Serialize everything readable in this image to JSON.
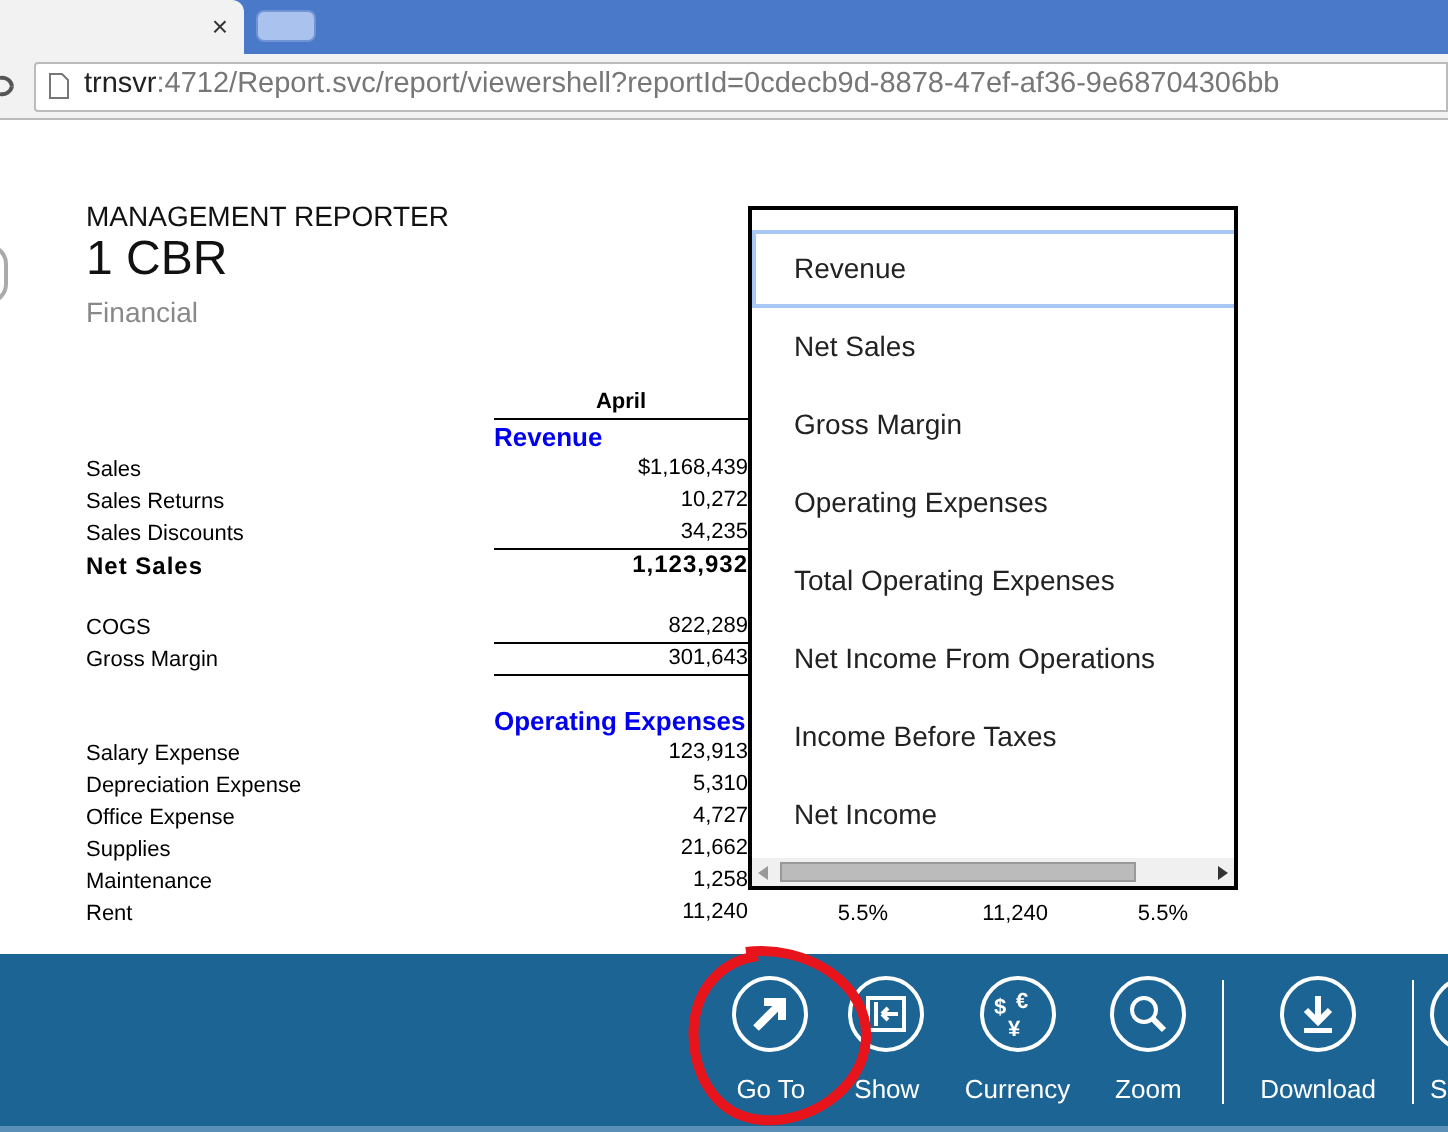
{
  "browser": {
    "tab_close": "×",
    "url_host": "trnsvr",
    "url_path": ":4712/Report.svc/report/viewershell?reportId=0cdecb9d-8878-47ef-af36-9e68704306bb"
  },
  "report": {
    "brand": "MANAGEMENT REPORTER",
    "title": "1 CBR",
    "subtitle": "Financial",
    "column_header": "April",
    "rows": [
      {
        "kind": "heading",
        "label": "Revenue"
      },
      {
        "kind": "row",
        "label": "Sales",
        "value": "$1,168,439",
        "rule_below": false
      },
      {
        "kind": "row",
        "label": "Sales Returns",
        "value": "10,272",
        "rule_below": false
      },
      {
        "kind": "row",
        "label": "Sales Discounts",
        "value": "34,235",
        "rule_below": true
      },
      {
        "kind": "total",
        "label": "Net Sales",
        "value": "1,123,932",
        "rule_below": false
      },
      {
        "kind": "spacer"
      },
      {
        "kind": "row",
        "label": "COGS",
        "value": "822,289",
        "rule_below": true
      },
      {
        "kind": "row",
        "label": "Gross Margin",
        "value": "301,643",
        "rule_below": true
      },
      {
        "kind": "spacer"
      },
      {
        "kind": "heading",
        "label": "Operating Expenses"
      },
      {
        "kind": "row",
        "label": "Salary Expense",
        "value": "123,913",
        "rule_below": false
      },
      {
        "kind": "row",
        "label": "Depreciation Expense",
        "value": "5,310",
        "rule_below": false
      },
      {
        "kind": "row",
        "label": "Office Expense",
        "value": "4,727",
        "rule_below": false
      },
      {
        "kind": "row",
        "label": "Supplies",
        "value": "21,662",
        "rule_below": false
      },
      {
        "kind": "row",
        "label": "Maintenance",
        "value": "1,258",
        "rule_below": false
      },
      {
        "kind": "row",
        "label": "Rent",
        "value": "11,240",
        "rule_below": false,
        "extra": [
          "5.5%",
          "11,240",
          "5.5%"
        ]
      }
    ]
  },
  "goto_menu": {
    "items": [
      {
        "label": "Revenue",
        "selected": true
      },
      {
        "label": "Net Sales",
        "selected": false
      },
      {
        "label": "Gross Margin",
        "selected": false
      },
      {
        "label": "Operating Expenses",
        "selected": false
      },
      {
        "label": "Total Operating Expenses",
        "selected": false
      },
      {
        "label": "Net Income From Operations",
        "selected": false
      },
      {
        "label": "Income Before Taxes",
        "selected": false
      },
      {
        "label": "Net Income",
        "selected": false
      }
    ]
  },
  "toolbar": [
    {
      "kind": "goto",
      "label": "Go To"
    },
    {
      "kind": "show",
      "label": "Show"
    },
    {
      "kind": "currency",
      "label": "Currency",
      "glyphs": [
        "$",
        "€",
        "¥"
      ]
    },
    {
      "kind": "zoom",
      "label": "Zoom"
    },
    {
      "kind": "divider"
    },
    {
      "kind": "download",
      "label": "Download"
    },
    {
      "kind": "divider"
    },
    {
      "kind": "partial",
      "label": "S"
    }
  ]
}
